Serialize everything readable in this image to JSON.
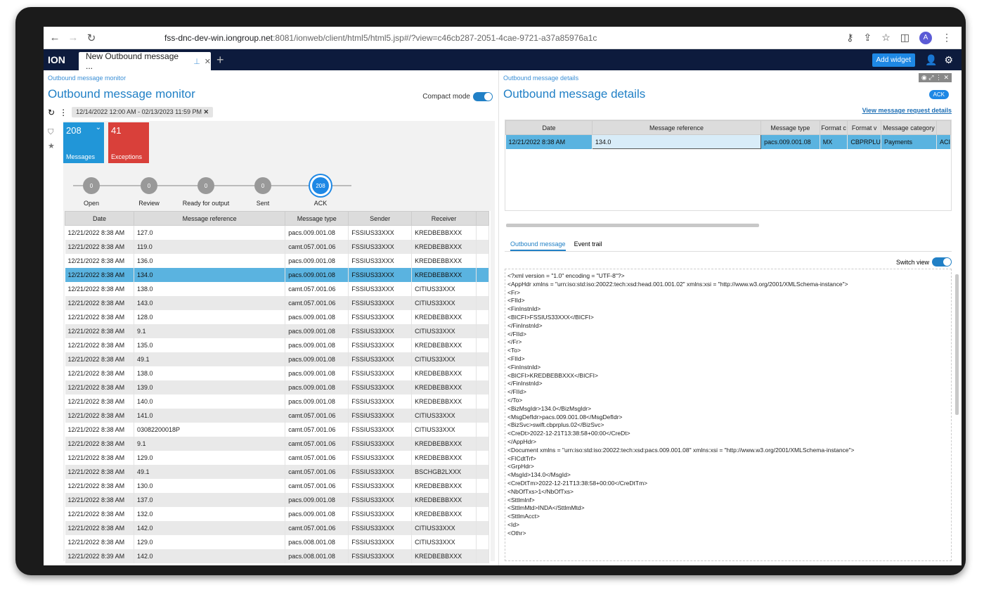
{
  "browser": {
    "url_host": "fss-dnc-dev-win.iongroup.net",
    "url_path": ":8081/ionweb/client/html5/html5.jsp#/?view=c46cb287-2051-4cae-9721-a37a85976a1c",
    "avatar": "A"
  },
  "app": {
    "logo": "ION",
    "tab_label": "New Outbound message ...",
    "add_widget": "Add widget"
  },
  "left": {
    "crumb": "Outbound message monitor",
    "title": "Outbound message monitor",
    "compact_label": "Compact mode",
    "date_filter": "12/14/2022 12:00 AM - 02/13/2023 11:59 PM",
    "tiles": [
      {
        "count": "208",
        "label": "Messages",
        "color": "#2196d8"
      },
      {
        "count": "41",
        "label": "Exceptions",
        "color": "#d9403a"
      }
    ],
    "steps": [
      {
        "count": "0",
        "label": "Open"
      },
      {
        "count": "0",
        "label": "Review"
      },
      {
        "count": "0",
        "label": "Ready for output"
      },
      {
        "count": "0",
        "label": "Sent"
      },
      {
        "count": "208",
        "label": "ACK"
      }
    ],
    "columns": [
      "Date",
      "Message reference",
      "Message type",
      "Sender",
      "Receiver"
    ],
    "rows": [
      [
        "12/21/2022 8:38 AM",
        "127.0",
        "pacs.009.001.08",
        "FSSIUS33XXX",
        "KREDBEBBXXX"
      ],
      [
        "12/21/2022 8:38 AM",
        "119.0",
        "camt.057.001.06",
        "FSSIUS33XXX",
        "KREDBEBBXXX"
      ],
      [
        "12/21/2022 8:38 AM",
        "136.0",
        "pacs.009.001.08",
        "FSSIUS33XXX",
        "KREDBEBBXXX"
      ],
      [
        "12/21/2022 8:38 AM",
        "134.0",
        "pacs.009.001.08",
        "FSSIUS33XXX",
        "KREDBEBBXXX"
      ],
      [
        "12/21/2022 8:38 AM",
        "138.0",
        "camt.057.001.06",
        "FSSIUS33XXX",
        "CITIUS33XXX"
      ],
      [
        "12/21/2022 8:38 AM",
        "143.0",
        "camt.057.001.06",
        "FSSIUS33XXX",
        "CITIUS33XXX"
      ],
      [
        "12/21/2022 8:38 AM",
        "128.0",
        "pacs.009.001.08",
        "FSSIUS33XXX",
        "KREDBEBBXXX"
      ],
      [
        "12/21/2022 8:38 AM",
        "9.1",
        "pacs.009.001.08",
        "FSSIUS33XXX",
        "CITIUS33XXX"
      ],
      [
        "12/21/2022 8:38 AM",
        "135.0",
        "pacs.009.001.08",
        "FSSIUS33XXX",
        "KREDBEBBXXX"
      ],
      [
        "12/21/2022 8:38 AM",
        "49.1",
        "pacs.009.001.08",
        "FSSIUS33XXX",
        "CITIUS33XXX"
      ],
      [
        "12/21/2022 8:38 AM",
        "138.0",
        "pacs.009.001.08",
        "FSSIUS33XXX",
        "KREDBEBBXXX"
      ],
      [
        "12/21/2022 8:38 AM",
        "139.0",
        "pacs.009.001.08",
        "FSSIUS33XXX",
        "KREDBEBBXXX"
      ],
      [
        "12/21/2022 8:38 AM",
        "140.0",
        "pacs.009.001.08",
        "FSSIUS33XXX",
        "KREDBEBBXXX"
      ],
      [
        "12/21/2022 8:38 AM",
        "141.0",
        "camt.057.001.06",
        "FSSIUS33XXX",
        "CITIUS33XXX"
      ],
      [
        "12/21/2022 8:38 AM",
        "03082200018P",
        "camt.057.001.06",
        "FSSIUS33XXX",
        "CITIUS33XXX"
      ],
      [
        "12/21/2022 8:38 AM",
        "9.1",
        "camt.057.001.06",
        "FSSIUS33XXX",
        "KREDBEBBXXX"
      ],
      [
        "12/21/2022 8:38 AM",
        "129.0",
        "camt.057.001.06",
        "FSSIUS33XXX",
        "KREDBEBBXXX"
      ],
      [
        "12/21/2022 8:38 AM",
        "49.1",
        "camt.057.001.06",
        "FSSIUS33XXX",
        "BSCHGB2LXXX"
      ],
      [
        "12/21/2022 8:38 AM",
        "130.0",
        "camt.057.001.06",
        "FSSIUS33XXX",
        "KREDBEBBXXX"
      ],
      [
        "12/21/2022 8:38 AM",
        "137.0",
        "pacs.009.001.08",
        "FSSIUS33XXX",
        "KREDBEBBXXX"
      ],
      [
        "12/21/2022 8:38 AM",
        "132.0",
        "pacs.009.001.08",
        "FSSIUS33XXX",
        "KREDBEBBXXX"
      ],
      [
        "12/21/2022 8:38 AM",
        "142.0",
        "camt.057.001.06",
        "FSSIUS33XXX",
        "CITIUS33XXX"
      ],
      [
        "12/21/2022 8:38 AM",
        "129.0",
        "pacs.008.001.08",
        "FSSIUS33XXX",
        "CITIUS33XXX"
      ],
      [
        "12/21/2022 8:39 AM",
        "142.0",
        "pacs.008.001.08",
        "FSSIUS33XXX",
        "KREDBEBBXXX"
      ]
    ],
    "selected_row": 3
  },
  "right": {
    "crumb": "Outbound message details",
    "title": "Outbound message details",
    "ack_badge": "ACK",
    "request_link": "View message request details",
    "columns": [
      "Date",
      "Message reference",
      "Message type",
      "Format c",
      "Format v",
      "Message category",
      ""
    ],
    "row": [
      "12/21/2022 8:38 AM",
      "134.0",
      "pacs.009.001.08",
      "MX",
      "CBPRPLU",
      "Payments",
      "ACI"
    ],
    "tabs": [
      "Outbound message",
      "Event trail"
    ],
    "switch_label": "Switch view",
    "xml": "<?xml version = \"1.0\" encoding = \"UTF-8\"?>\n<AppHdr xmlns = \"urn:iso:std:iso:20022:tech:xsd:head.001.001.02\" xmlns:xsi = \"http://www.w3.org/2001/XMLSchema-instance\">\n<Fr>\n<FIId>\n<FinInstnId>\n<BICFI>FSSIUS33XXX</BICFI>\n</FinInstnId>\n</FIId>\n</Fr>\n<To>\n<FIId>\n<FinInstnId>\n<BICFI>KREDBEBBXXX</BICFI>\n</FinInstnId>\n</FIId>\n</To>\n<BizMsgIdr>134.0</BizMsgIdr>\n<MsgDefIdr>pacs.009.001.08</MsgDefIdr>\n<BizSvc>swift.cbprplus.02</BizSvc>\n<CreDt>2022-12-21T13:38:58+00:00</CreDt>\n</AppHdr>\n<Document xmlns = \"urn:iso:std:iso:20022:tech:xsd:pacs.009.001.08\" xmlns:xsi = \"http://www.w3.org/2001/XMLSchema-instance\">\n<FICdtTrf>\n<GrpHdr>\n<MsgId>134.0</MsgId>\n<CreDtTm>2022-12-21T13:38:58+00:00</CreDtTm>\n<NbOfTxs>1</NbOfTxs>\n<SttlmInf>\n<SttlmMtd>INDA</SttlmMtd>\n<SttlmAcct>\n<Id>\n<Othr>"
  }
}
